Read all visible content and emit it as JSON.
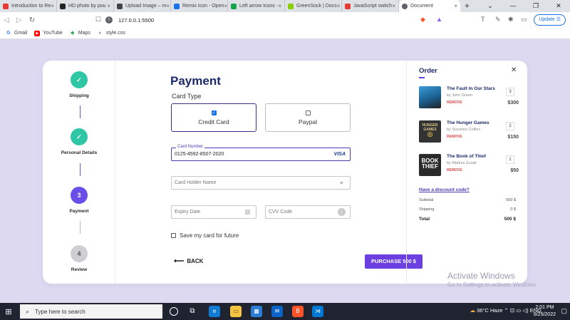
{
  "browser": {
    "tabs": [
      {
        "label": "Introduction to Re",
        "color": "#e53935"
      },
      {
        "label": "HD photo by pou",
        "color": "#222222"
      },
      {
        "label": "Upload Image – m",
        "color": "#444444"
      },
      {
        "label": "Remix Icon - Open",
        "color": "#1a73e8"
      },
      {
        "label": "Left arrow Icons -",
        "color": "#17a34a"
      },
      {
        "label": "GreenSock | Docs",
        "color": "#88ce02"
      },
      {
        "label": "JavaScript switch",
        "color": "#e53935"
      },
      {
        "label": "Document",
        "color": "#5f6368"
      }
    ],
    "url": "127.0.0.1:5500",
    "update_label": "Update",
    "bookmarks": [
      {
        "label": "Gmail",
        "icon": "G"
      },
      {
        "label": "YouTube",
        "icon": "▶"
      },
      {
        "label": "Maps",
        "icon": "◆"
      },
      {
        "label": "style.css",
        "icon": "◐"
      }
    ]
  },
  "steps": [
    {
      "label": "Shipping",
      "status": "done",
      "mark": "✓"
    },
    {
      "label": "Personal Details",
      "status": "done",
      "mark": "✓"
    },
    {
      "label": "Payment",
      "status": "current",
      "mark": "3"
    },
    {
      "label": "Review",
      "status": "todo",
      "mark": "4"
    }
  ],
  "payment": {
    "title": "Payment",
    "card_type_label": "Card Type",
    "options": {
      "credit": "Credit Card",
      "paypal": "Paypal"
    },
    "card_number_label": "Card Number",
    "card_number": "0125-4592-8507-2020",
    "card_brand": "VISA",
    "holder_placeholder": "Card Holder Name",
    "expiry_placeholder": "Expiry Date",
    "cvv_placeholder": "CVV Code",
    "save_card_label": "Save my card for future",
    "back_label": "BACK",
    "purchase_label": "PURCHASE 500 $"
  },
  "order": {
    "title": "Order",
    "items": [
      {
        "name": "The Fault In Our Stars",
        "author": "by John Green",
        "remove": "REMOVE",
        "qty": "3",
        "price": "$300",
        "cover_color": "#2c7fb8",
        "cover_text": ""
      },
      {
        "name": "The Hunger Games",
        "author": "by Suzanne Collins",
        "remove": "REMOVE",
        "qty": "2",
        "price": "$150",
        "cover_color": "#3a3a3a",
        "cover_text": "HUNGER GAMES"
      },
      {
        "name": "The Book of Thief",
        "author": "by Markus Zusak",
        "remove": "REMOVE",
        "qty": "1",
        "price": "$50",
        "cover_color": "#2a2a2a",
        "cover_text": "BOOK THIEF"
      }
    ],
    "discount_label": "Have a discount code?",
    "subtotal_label": "Subtotal",
    "subtotal": "500 $",
    "shipping_label": "Shipping",
    "shipping": "0 $",
    "total_label": "Total",
    "total": "500 $"
  },
  "watermark": {
    "title": "Activate Windows",
    "subtitle": "Go to Settings to activate Windows."
  },
  "taskbar": {
    "search_placeholder": "Type here to search",
    "weather": "36°C  Haze",
    "time": "2:01 PM",
    "date": "6/25/2022"
  }
}
